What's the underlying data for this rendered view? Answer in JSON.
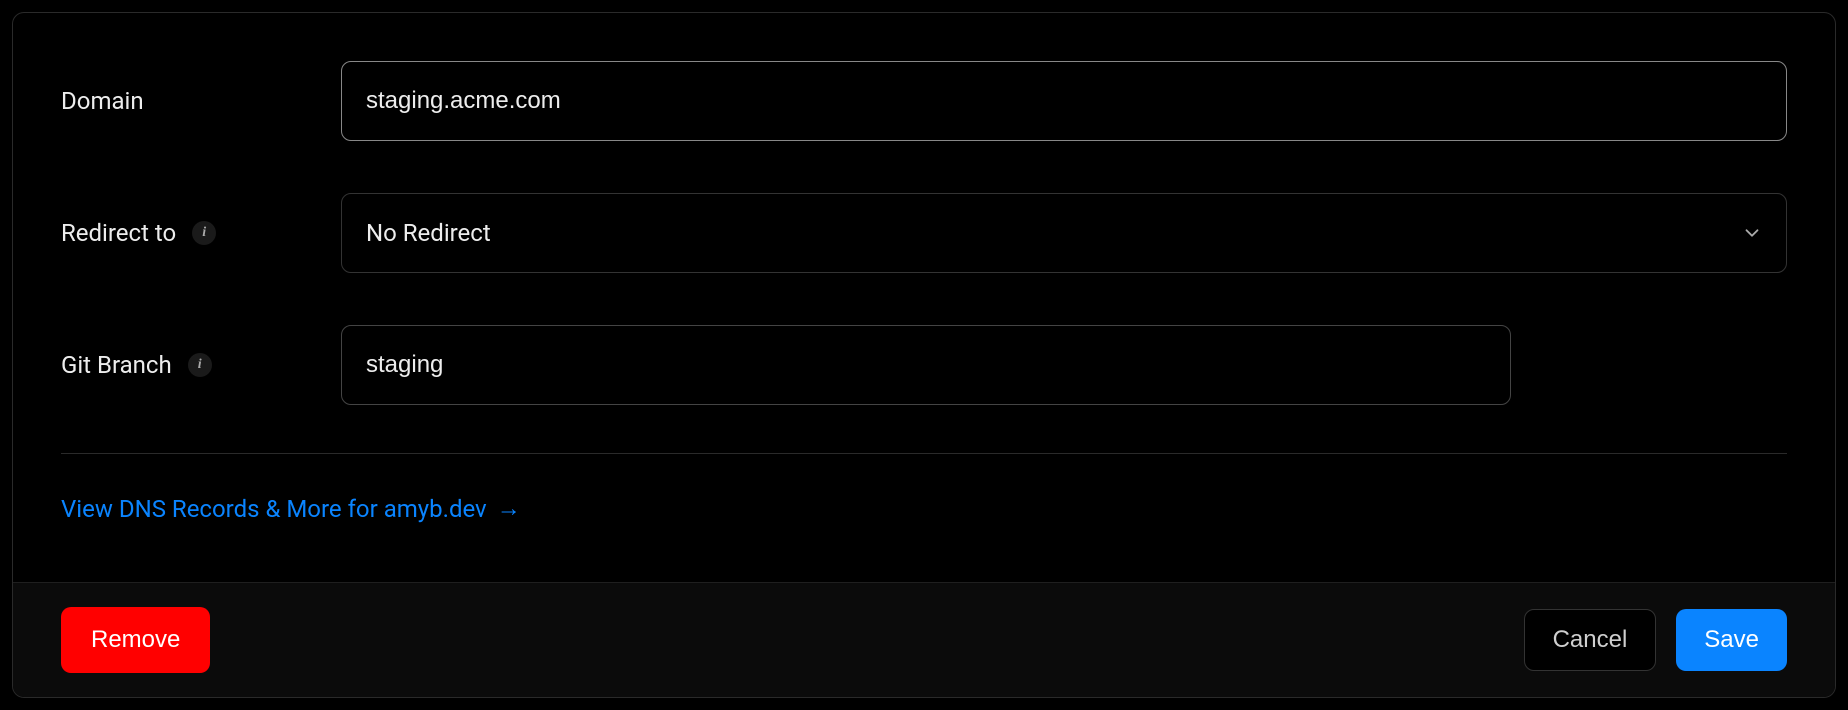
{
  "fields": {
    "domain": {
      "label": "Domain",
      "value": "staging.acme.com"
    },
    "redirect": {
      "label": "Redirect to",
      "selected": "No Redirect"
    },
    "branch": {
      "label": "Git Branch",
      "value": "staging"
    }
  },
  "link": {
    "text": "View DNS Records & More for amyb.dev",
    "arrow": "→"
  },
  "buttons": {
    "remove": "Remove",
    "cancel": "Cancel",
    "save": "Save"
  },
  "icons": {
    "info": "i"
  }
}
